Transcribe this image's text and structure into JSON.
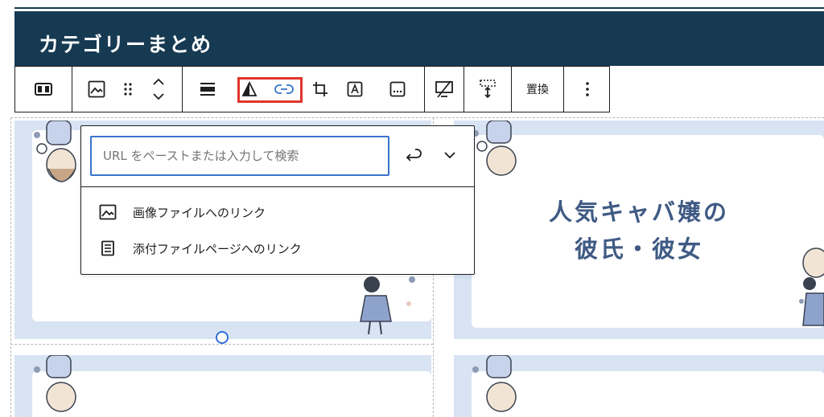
{
  "header": {
    "title": "カテゴリーまとめ"
  },
  "toolbar": {
    "replace_label": "置換"
  },
  "link_popover": {
    "url_placeholder": "URL をペーストまたは入力して検索",
    "options": [
      {
        "label": "画像ファイルへのリンク",
        "icon": "image-icon"
      },
      {
        "label": "添付ファイルページへのリンク",
        "icon": "page-icon"
      }
    ]
  },
  "cards": {
    "right_top_text": [
      "人気キャバ嬢の",
      "彼氏・彼女"
    ]
  },
  "colors": {
    "header_bg": "#163a52",
    "card_bg": "#d8e3f3",
    "card_text": "#3f5a84",
    "accent_blue": "#3874cb",
    "highlight_red": "#e0352b"
  }
}
